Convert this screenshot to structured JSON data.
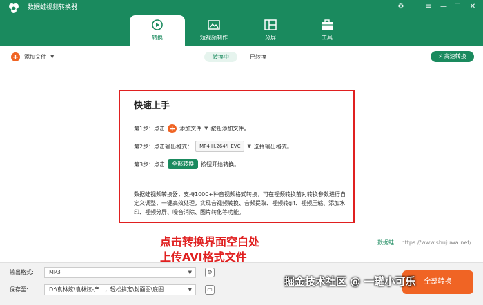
{
  "app": {
    "title": "数据蛙视频转换器",
    "window_controls": [
      "gear-icon",
      "menu-icon",
      "minimize-icon",
      "maximize-icon",
      "close-icon"
    ]
  },
  "tabs": [
    {
      "label": "转换",
      "icon": "convert-icon",
      "active": true
    },
    {
      "label": "短视频制作",
      "icon": "picture-icon",
      "active": false
    },
    {
      "label": "分屏",
      "icon": "split-screen-icon",
      "active": false
    },
    {
      "label": "工具",
      "icon": "toolbox-icon",
      "active": false
    }
  ],
  "toolbar": {
    "add_file": "添加文件",
    "seg": [
      "转换中",
      "已转换"
    ],
    "fast": "高速转换"
  },
  "guide": {
    "title": "快速上手",
    "step1_prefix": "第1步：点击",
    "step1_btn": "添加文件",
    "step1_suffix": "按钮添加文件。",
    "step2_prefix": "第2步：点击输出格式：",
    "step2_fmt": "MP4 H.264/HEVC",
    "step2_suffix": "选择输出格式。",
    "step3_prefix": "第3步：点击",
    "step3_btn": "全部转换",
    "step3_suffix": "按钮开始转换。",
    "desc": "数据蛙视频转换器，支持1000+种音视频格式转换，可在视频转换前对转换参数进行自定义调整，一键高效处理，实现音视频转换、音频提取、视频转gif、视频压缩、添加水印、视频分屏、噪音消除、图片转化等功能。"
  },
  "annotation": {
    "line1": "点击转换界面空白处",
    "line2": "上传AVI格式文件"
  },
  "watermark": {
    "brand": "数据蛙",
    "url": "https://www.shujuwa.net/"
  },
  "bottom": {
    "format_label": "输出格式:",
    "format_value": "MP3",
    "save_label": "保存至:",
    "save_value": "D:\\袁林炫\\袁林炫-产...，轻松搞定\\封面图\\底图",
    "convert_btn": "全部转换"
  },
  "overlay": {
    "csdn": "掘金技术社区 @ 一罐小可乐"
  },
  "colors": {
    "brand": "#1a8a5e",
    "accent": "#f06424",
    "annotation": "#e02020"
  }
}
